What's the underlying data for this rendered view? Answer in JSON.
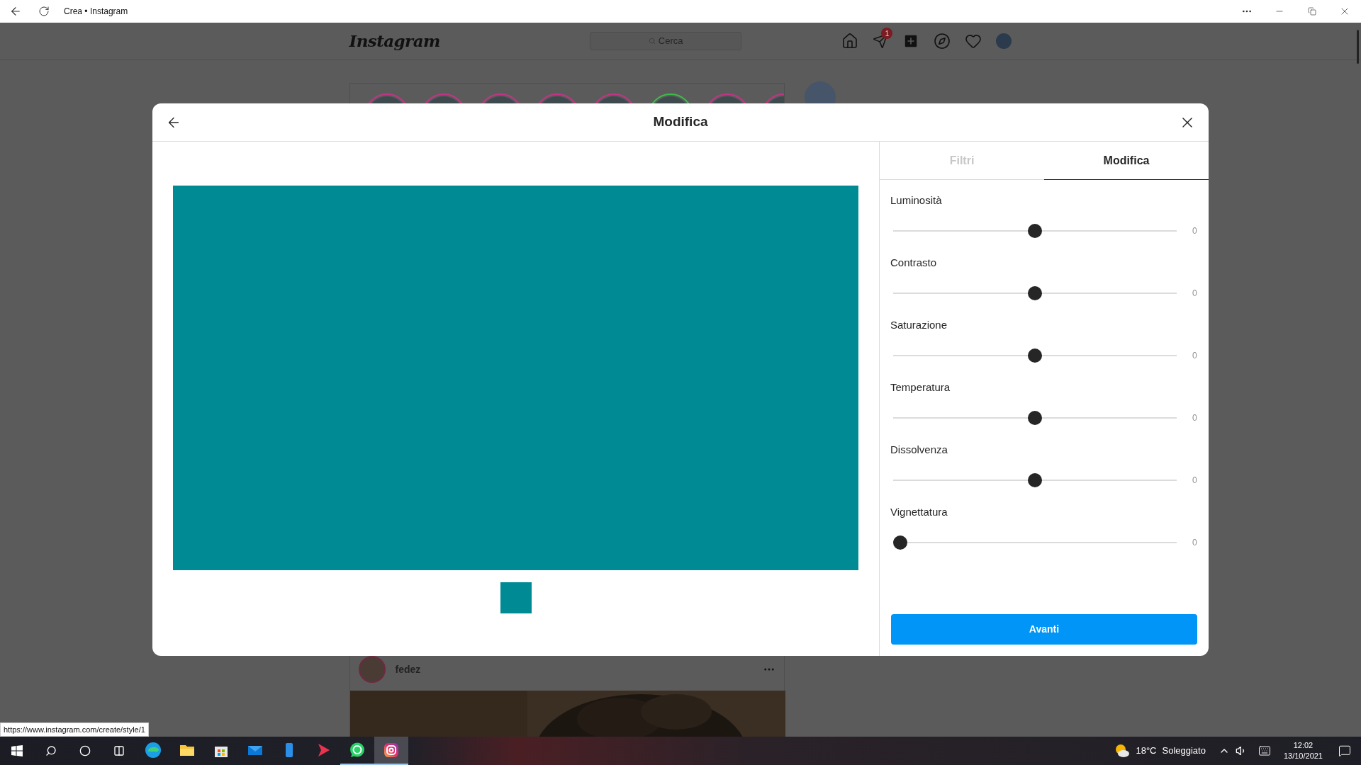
{
  "browser": {
    "title": "Crea • Instagram"
  },
  "instagram": {
    "logo": "Instagram",
    "search_placeholder": "Cerca",
    "notification_badge": "1",
    "stories": [
      {
        "color": "#c13584"
      },
      {
        "color": "#c13584"
      },
      {
        "color": "#c13584"
      },
      {
        "color": "#c13584"
      },
      {
        "color": "#c13584"
      },
      {
        "color": "#3dbb4a"
      },
      {
        "color": "#c13584"
      },
      {
        "color": "#c13584"
      }
    ]
  },
  "modal": {
    "title": "Modifica",
    "tabs": [
      {
        "label": "Filtri",
        "selected": false
      },
      {
        "label": "Modifica",
        "selected": true
      }
    ],
    "adjustments": [
      {
        "label": "Luminosità",
        "level": 0.5,
        "reading": "0"
      },
      {
        "label": "Contrasto",
        "level": 0.5,
        "reading": "0"
      },
      {
        "label": "Saturazione",
        "level": 0.5,
        "reading": "0"
      },
      {
        "label": "Temperatura",
        "level": 0.5,
        "reading": "0"
      },
      {
        "label": "Dissolvenza",
        "level": 0.5,
        "reading": "0"
      },
      {
        "label": "Vignettatura",
        "level": 0,
        "reading": "0"
      }
    ],
    "button": "Avanti"
  },
  "post": {
    "username": "fedez"
  },
  "status_url": "https://www.instagram.com/create/style/1",
  "taskbar": {
    "apps": [
      {
        "kind": "edge",
        "open": false,
        "selected": false
      },
      {
        "kind": "folder",
        "open": false,
        "selected": false
      },
      {
        "kind": "store",
        "open": false,
        "selected": false
      },
      {
        "kind": "mail",
        "open": false,
        "selected": false
      },
      {
        "kind": "phone",
        "open": false,
        "selected": false
      },
      {
        "kind": "play",
        "open": false,
        "selected": false
      },
      {
        "kind": "chat",
        "open": true,
        "selected": false
      },
      {
        "kind": "camera",
        "open": true,
        "selected": true
      }
    ],
    "weather": {
      "temperature": "18°C",
      "condition": "Soleggiato"
    },
    "time": "12:02",
    "date": "13/10/2021"
  }
}
